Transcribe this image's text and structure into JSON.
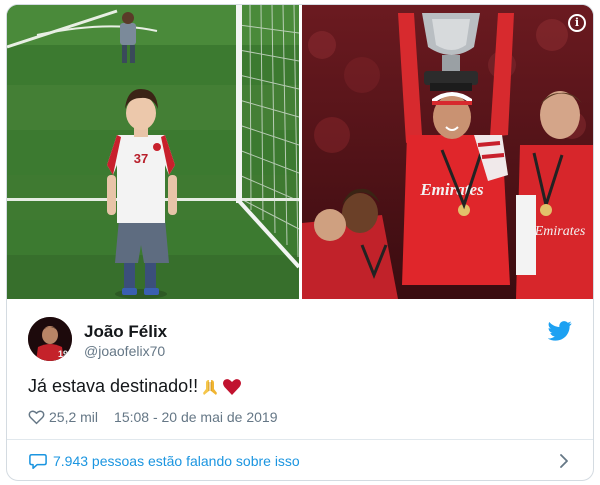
{
  "author": {
    "display_name": "João Félix",
    "handle": "@joaofelix70"
  },
  "tweet": {
    "text": "Já estava destinado!!",
    "emojis": [
      "folded-hands-icon",
      "red-heart-icon"
    ]
  },
  "stats": {
    "likes": "25,2 mil",
    "timestamp": "15:08 - 20 de mai de 2019"
  },
  "conversation": {
    "label": "7.943 pessoas estão falando sobre isso"
  },
  "media": {
    "left_photo_shirt": "37",
    "right_photo_shirt": "Emirates"
  },
  "colors": {
    "brand_blue": "#1da1f2",
    "link_blue": "#1b95e0",
    "muted_text": "#657786",
    "heart_red": "#c1122f"
  },
  "icons": [
    "info-icon",
    "twitter-bird-icon",
    "heart-outline-icon",
    "speech-bubble-icon",
    "chevron-right-icon"
  ]
}
